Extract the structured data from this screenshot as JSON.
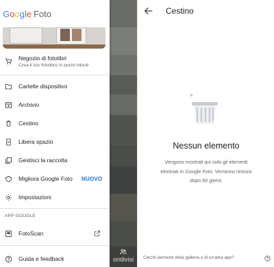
{
  "drawer": {
    "brand": {
      "google": "Google",
      "product": "Foto"
    },
    "items": [
      {
        "icon": "cart-icon",
        "label": "Negozio di fotolibri",
        "sublabel": "Crea il tuo fotolibro in pochi minuti"
      },
      {
        "icon": "folder-icon",
        "label": "Cartelle dispositivo"
      },
      {
        "icon": "archive-icon",
        "label": "Archivio"
      },
      {
        "icon": "trash-icon",
        "label": "Cestino"
      },
      {
        "icon": "phone-free-space-icon",
        "label": "Libera spazio"
      },
      {
        "icon": "collection-icon",
        "label": "Gestisci la raccolta"
      },
      {
        "icon": "feedback-icon",
        "label": "Migliora Google Foto",
        "badge": "NUOVO"
      },
      {
        "icon": "gear-icon",
        "label": "Impostazioni"
      }
    ],
    "section_title": "APP GOOGLE",
    "apps": [
      {
        "icon": "fotoscan-icon",
        "label": "FotoScan",
        "trailing_icon": "open-external-icon"
      },
      {
        "icon": "help-icon",
        "label": "Guida e feedback"
      }
    ]
  },
  "scrim": {
    "bottom_label": "ondivisi",
    "icon": "shared-people-icon"
  },
  "trash_screen": {
    "title": "Cestino",
    "back_icon": "arrow-back-icon",
    "illustration": "trash-bin-illustration",
    "empty_title": "Nessun elemento",
    "empty_description": "Vengono mostrati qui solo gli elementi eliminati in Google Foto. Verranno rimossi dopo 60 giorni.",
    "help_text": "Cerchi elementi della galleria o di un'altra app?",
    "help_icon": "question-circle-icon"
  },
  "colors": {
    "google_blue": "#4285F4",
    "google_red": "#EA4335",
    "google_yellow": "#FBBC05",
    "google_green": "#34A853",
    "accent": "#1a73e8",
    "text_primary": "#202124",
    "text_secondary": "#5f6368",
    "illustration": "#c7ccd1"
  }
}
